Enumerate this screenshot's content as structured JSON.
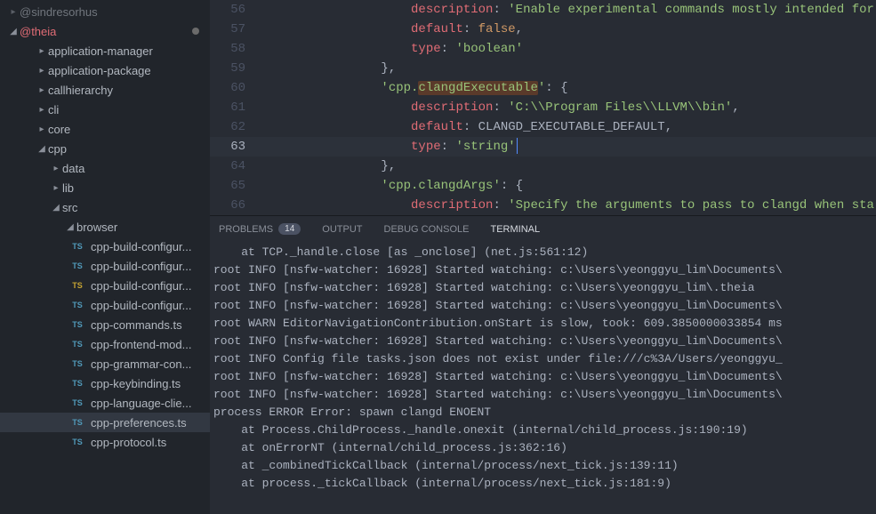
{
  "sidebar": {
    "topItem": "@sindresorhus",
    "root": "@theia",
    "items": [
      {
        "label": "application-manager",
        "depth": 2,
        "expandIcon": "▸"
      },
      {
        "label": "application-package",
        "depth": 2,
        "expandIcon": "▸"
      },
      {
        "label": "callhierarchy",
        "depth": 2,
        "expandIcon": "▸"
      },
      {
        "label": "cli",
        "depth": 2,
        "expandIcon": "▸"
      },
      {
        "label": "core",
        "depth": 2,
        "expandIcon": "▸"
      },
      {
        "label": "cpp",
        "depth": 2,
        "expandIcon": "◢"
      },
      {
        "label": "data",
        "depth": 3,
        "expandIcon": "▸"
      },
      {
        "label": "lib",
        "depth": 3,
        "expandIcon": "▸"
      },
      {
        "label": "src",
        "depth": 3,
        "expandIcon": "◢"
      },
      {
        "label": "browser",
        "depth": 4,
        "expandIcon": "◢"
      }
    ],
    "files": [
      {
        "label": "cpp-build-configur...",
        "ts": "blue"
      },
      {
        "label": "cpp-build-configur...",
        "ts": "blue"
      },
      {
        "label": "cpp-build-configur...",
        "ts": "yellow"
      },
      {
        "label": "cpp-build-configur...",
        "ts": "blue"
      },
      {
        "label": "cpp-commands.ts",
        "ts": "blue"
      },
      {
        "label": "cpp-frontend-mod...",
        "ts": "blue"
      },
      {
        "label": "cpp-grammar-con...",
        "ts": "blue"
      },
      {
        "label": "cpp-keybinding.ts",
        "ts": "blue"
      },
      {
        "label": "cpp-language-clie...",
        "ts": "blue"
      },
      {
        "label": "cpp-preferences.ts",
        "ts": "blue",
        "selected": true
      },
      {
        "label": "cpp-protocol.ts",
        "ts": "blue"
      }
    ]
  },
  "editor": {
    "lines": [
      {
        "n": 56,
        "tokens": [
          {
            "t": "                    ",
            "c": ""
          },
          {
            "t": "description",
            "c": "c-key"
          },
          {
            "t": ": ",
            "c": "c-punc"
          },
          {
            "t": "'Enable experimental commands mostly intended for",
            "c": "c-str"
          }
        ]
      },
      {
        "n": 57,
        "tokens": [
          {
            "t": "                    ",
            "c": ""
          },
          {
            "t": "default",
            "c": "c-key"
          },
          {
            "t": ": ",
            "c": "c-punc"
          },
          {
            "t": "false",
            "c": "c-const"
          },
          {
            "t": ",",
            "c": "c-punc"
          }
        ]
      },
      {
        "n": 58,
        "tokens": [
          {
            "t": "                    ",
            "c": ""
          },
          {
            "t": "type",
            "c": "c-key"
          },
          {
            "t": ": ",
            "c": "c-punc"
          },
          {
            "t": "'boolean'",
            "c": "c-str"
          }
        ]
      },
      {
        "n": 59,
        "tokens": [
          {
            "t": "                },",
            "c": "c-punc"
          }
        ]
      },
      {
        "n": 60,
        "tokens": [
          {
            "t": "                ",
            "c": ""
          },
          {
            "t": "'cpp.",
            "c": "c-str"
          },
          {
            "t": "clangdExecutable",
            "c": "c-str c-sel-bg"
          },
          {
            "t": "'",
            "c": "c-str"
          },
          {
            "t": ": {",
            "c": "c-punc"
          }
        ]
      },
      {
        "n": 61,
        "tokens": [
          {
            "t": "                    ",
            "c": ""
          },
          {
            "t": "description",
            "c": "c-key"
          },
          {
            "t": ": ",
            "c": "c-punc"
          },
          {
            "t": "'C:\\\\Program Files\\\\LLVM\\\\bin'",
            "c": "c-str"
          },
          {
            "t": ",",
            "c": "c-punc"
          }
        ]
      },
      {
        "n": 62,
        "tokens": [
          {
            "t": "                    ",
            "c": ""
          },
          {
            "t": "default",
            "c": "c-key"
          },
          {
            "t": ": ",
            "c": "c-punc"
          },
          {
            "t": "CLANGD_EXECUTABLE_DEFAULT",
            "c": "c-ident"
          },
          {
            "t": ",",
            "c": "c-punc"
          }
        ]
      },
      {
        "n": 63,
        "active": true,
        "tokens": [
          {
            "t": "                    ",
            "c": ""
          },
          {
            "t": "type",
            "c": "c-key"
          },
          {
            "t": ": ",
            "c": "c-punc"
          },
          {
            "t": "'string'",
            "c": "c-str"
          }
        ]
      },
      {
        "n": 64,
        "tokens": [
          {
            "t": "                },",
            "c": "c-punc"
          }
        ]
      },
      {
        "n": 65,
        "tokens": [
          {
            "t": "                ",
            "c": ""
          },
          {
            "t": "'cpp.clangdArgs'",
            "c": "c-str"
          },
          {
            "t": ": {",
            "c": "c-punc"
          }
        ]
      },
      {
        "n": 66,
        "tokens": [
          {
            "t": "                    ",
            "c": ""
          },
          {
            "t": "description",
            "c": "c-key"
          },
          {
            "t": ": ",
            "c": "c-punc"
          },
          {
            "t": "'Specify the arguments to pass to clangd when sta",
            "c": "c-str"
          }
        ]
      }
    ],
    "activeLine": 63
  },
  "panel": {
    "tabs": {
      "problems": "PROBLEMS",
      "problemsCount": "14",
      "output": "OUTPUT",
      "debug": "DEBUG CONSOLE",
      "terminal": "TERMINAL"
    },
    "terminal": [
      "    at TCP._handle.close [as _onclose] (net.js:561:12)",
      "root INFO [nsfw-watcher: 16928] Started watching: c:\\Users\\yeonggyu_lim\\Documents\\",
      "root INFO [nsfw-watcher: 16928] Started watching: c:\\Users\\yeonggyu_lim\\.theia",
      "root INFO [nsfw-watcher: 16928] Started watching: c:\\Users\\yeonggyu_lim\\Documents\\",
      "root WARN EditorNavigationContribution.onStart is slow, took: 609.3850000033854 ms",
      "root INFO [nsfw-watcher: 16928] Started watching: c:\\Users\\yeonggyu_lim\\Documents\\",
      "root INFO Config file tasks.json does not exist under file:///c%3A/Users/yeonggyu_",
      "root INFO [nsfw-watcher: 16928] Started watching: c:\\Users\\yeonggyu_lim\\Documents\\",
      "root INFO [nsfw-watcher: 16928] Started watching: c:\\Users\\yeonggyu_lim\\Documents\\",
      "process ERROR Error: spawn clangd ENOENT",
      "    at Process.ChildProcess._handle.onexit (internal/child_process.js:190:19)",
      "    at onErrorNT (internal/child_process.js:362:16)",
      "    at _combinedTickCallback (internal/process/next_tick.js:139:11)",
      "    at process._tickCallback (internal/process/next_tick.js:181:9)"
    ]
  }
}
